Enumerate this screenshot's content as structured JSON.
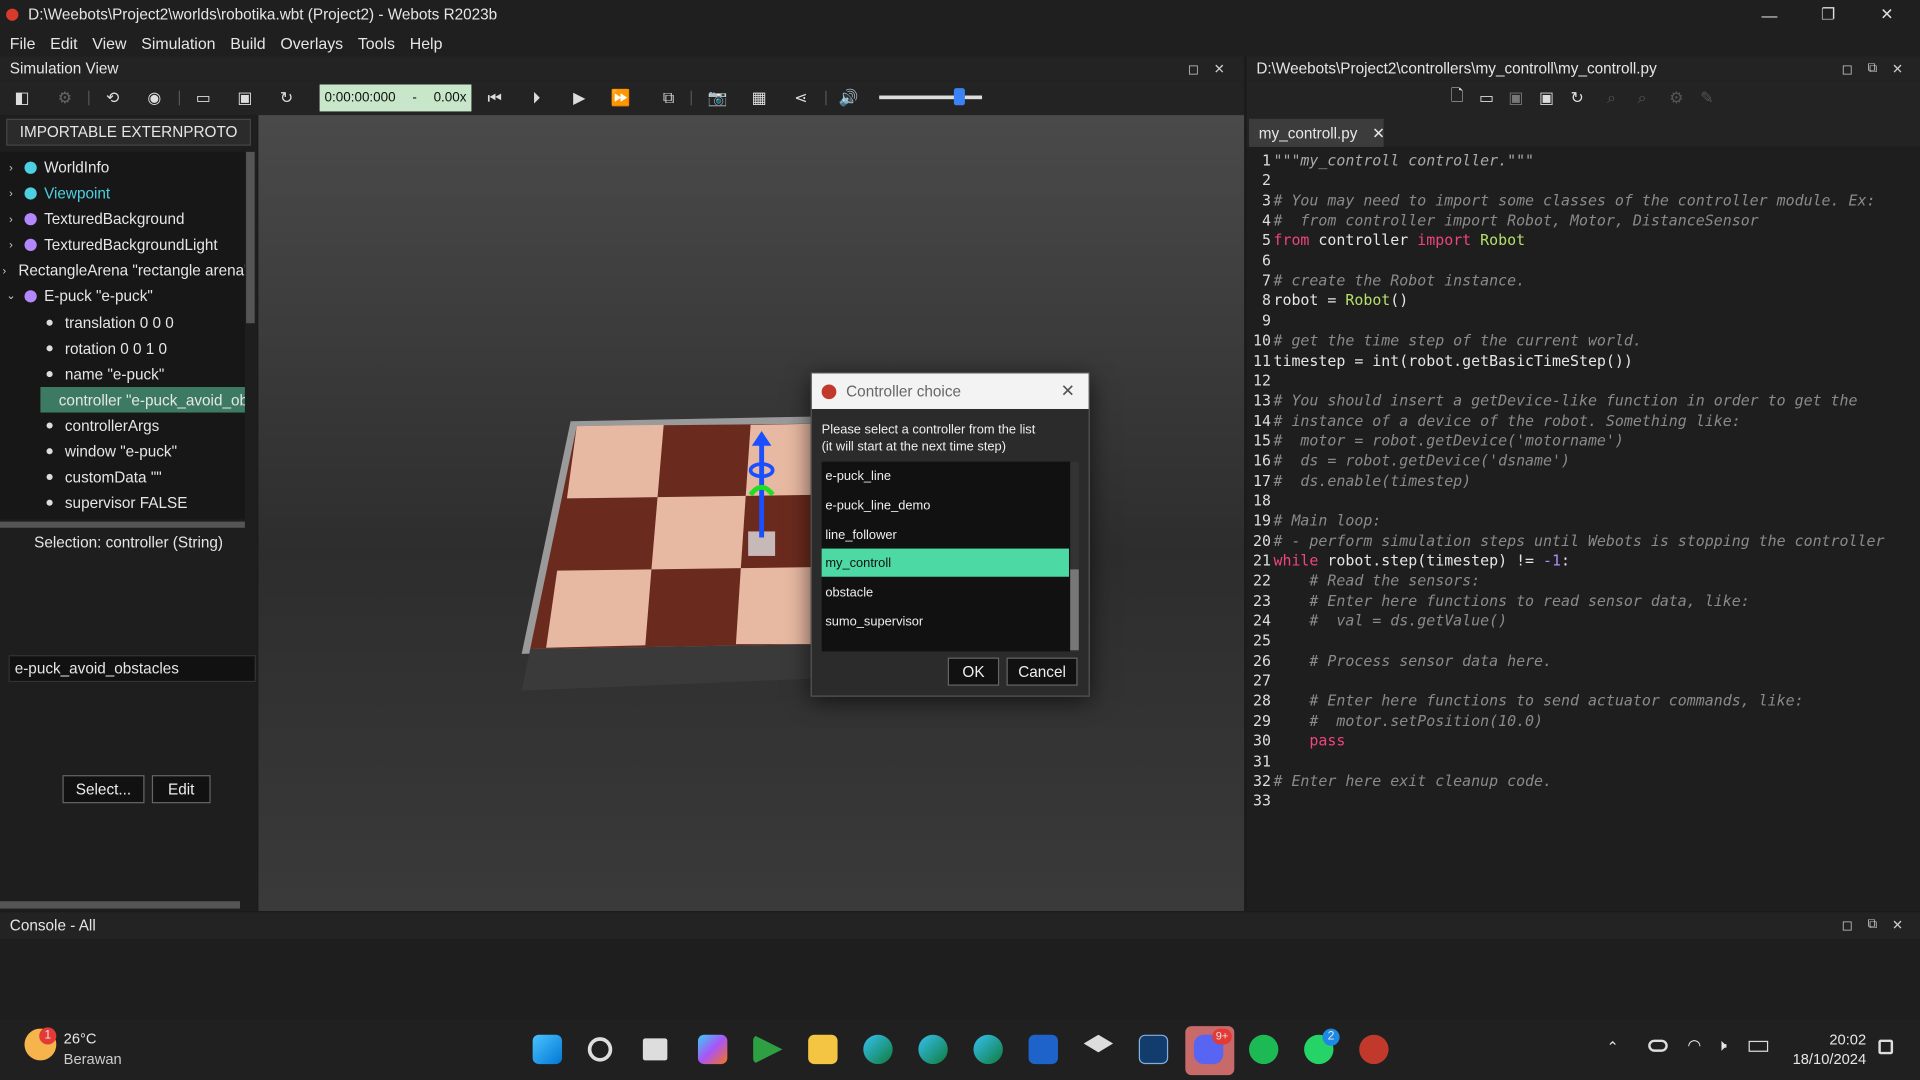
{
  "window": {
    "title": "D:\\Weebots\\Project2\\worlds\\robotika.wbt (Project2) - Webots R2023b"
  },
  "menu": [
    "File",
    "Edit",
    "View",
    "Simulation",
    "Build",
    "Overlays",
    "Tools",
    "Help"
  ],
  "sim_view": {
    "title": "Simulation View",
    "time": "0:00:00:000",
    "speed_sep": "-",
    "speed": "0.00x"
  },
  "scene_tree": {
    "proto_button": "IMPORTABLE EXTERNPROTO",
    "nodes": [
      {
        "label": "WorldInfo",
        "color": "#4dd0e1"
      },
      {
        "label": "Viewpoint",
        "color": "#4dd0e1"
      },
      {
        "label": "TexturedBackground",
        "color": "#b388ff"
      },
      {
        "label": "TexturedBackgroundLight",
        "color": "#b388ff"
      },
      {
        "label": "RectangleArena \"rectangle arena\"",
        "color": "#b388ff"
      },
      {
        "label": "E-puck \"e-puck\"",
        "color": "#b388ff"
      }
    ],
    "fields": [
      "translation 0 0 0",
      "rotation 0 0 1 0",
      "name \"e-puck\"",
      "controller \"e-puck_avoid_obstacles\"",
      "controllerArgs",
      "window \"e-puck\"",
      "customData \"\"",
      "supervisor FALSE"
    ],
    "selection": "Selection: controller (String)",
    "field_value": "e-puck_avoid_obstacles",
    "select_button": "Select...",
    "edit_button": "Edit"
  },
  "dialog": {
    "title": "Controller choice",
    "message_line1": "Please select a controller from the list",
    "message_line2": "(it will start at the next time step)",
    "items": [
      "e-puck_line",
      "e-puck_line_demo",
      "line_follower",
      "my_controll",
      "obstacle",
      "sumo_supervisor"
    ],
    "selected_index": 3,
    "ok": "OK",
    "cancel": "Cancel"
  },
  "editor": {
    "path": "D:\\Weebots\\Project2\\controllers\\my_controll\\my_controll.py",
    "tab": "my_controll.py",
    "lines": [
      [
        [
          "st",
          "\"\"\"my_controll controller.\"\"\""
        ]
      ],
      [],
      [
        [
          "cm",
          "# You may need to import some classes of the controller module. Ex:"
        ]
      ],
      [
        [
          "cm",
          "#  from controller import Robot, Motor, DistanceSensor"
        ]
      ],
      [
        [
          "kw",
          "from"
        ],
        [
          "tx",
          " controller "
        ],
        [
          "kw",
          "import"
        ],
        [
          "tx",
          " "
        ],
        [
          "fn",
          "Robot"
        ]
      ],
      [],
      [
        [
          "cm",
          "# create the Robot instance."
        ]
      ],
      [
        [
          "tx",
          "robot = "
        ],
        [
          "fn",
          "Robot"
        ],
        [
          "tx",
          "()"
        ]
      ],
      [],
      [
        [
          "cm",
          "# get the time step of the current world."
        ]
      ],
      [
        [
          "tx",
          "timestep = int(robot.getBasicTimeStep())"
        ]
      ],
      [],
      [
        [
          "cm",
          "# You should insert a getDevice-like function in order to get the"
        ]
      ],
      [
        [
          "cm",
          "# instance of a device of the robot. Something like:"
        ]
      ],
      [
        [
          "cm",
          "#  motor = robot.getDevice('motorname')"
        ]
      ],
      [
        [
          "cm",
          "#  ds = robot.getDevice('dsname')"
        ]
      ],
      [
        [
          "cm",
          "#  ds.enable(timestep)"
        ]
      ],
      [],
      [
        [
          "cm",
          "# Main loop:"
        ]
      ],
      [
        [
          "cm",
          "# - perform simulation steps until Webots is stopping the controller"
        ]
      ],
      [
        [
          "kw",
          "while"
        ],
        [
          "tx",
          " robot.step(timestep) != "
        ],
        [
          "nm",
          "-1"
        ],
        [
          "tx",
          ":"
        ]
      ],
      [
        [
          "cm",
          "    # Read the sensors:"
        ]
      ],
      [
        [
          "cm",
          "    # Enter here functions to read sensor data, like:"
        ]
      ],
      [
        [
          "cm",
          "    #  val = ds.getValue()"
        ]
      ],
      [],
      [
        [
          "cm",
          "    # Process sensor data here."
        ]
      ],
      [],
      [
        [
          "cm",
          "    # Enter here functions to send actuator commands, like:"
        ]
      ],
      [
        [
          "cm",
          "    #  motor.setPosition(10.0)"
        ]
      ],
      [
        [
          "tx",
          "    "
        ],
        [
          "kw",
          "pass"
        ]
      ],
      [],
      [
        [
          "cm",
          "# Enter here exit cleanup code."
        ]
      ],
      []
    ]
  },
  "console": {
    "title": "Console - All"
  },
  "taskbar": {
    "temp": "26°C",
    "weather": "Berawan",
    "weather_badge": "1",
    "time": "20:02",
    "date": "18/10/2024",
    "discord_badge": "9+",
    "whatsapp_badge": "2"
  }
}
